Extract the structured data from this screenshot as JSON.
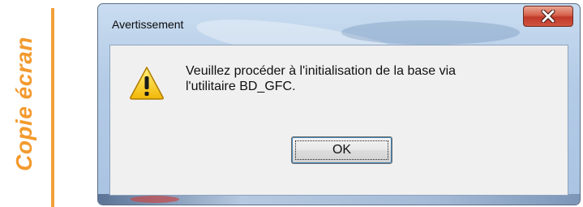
{
  "caption": {
    "text": "Copie écran",
    "color": "#f39a2e"
  },
  "dialog": {
    "title": "Avertissement",
    "close_icon": "close-icon",
    "message_lines": [
      "Veuillez procéder à l'initialisation de la base via",
      "l'utilitaire BD_GFC."
    ],
    "icon": "warning-icon",
    "ok_label": "OK"
  }
}
